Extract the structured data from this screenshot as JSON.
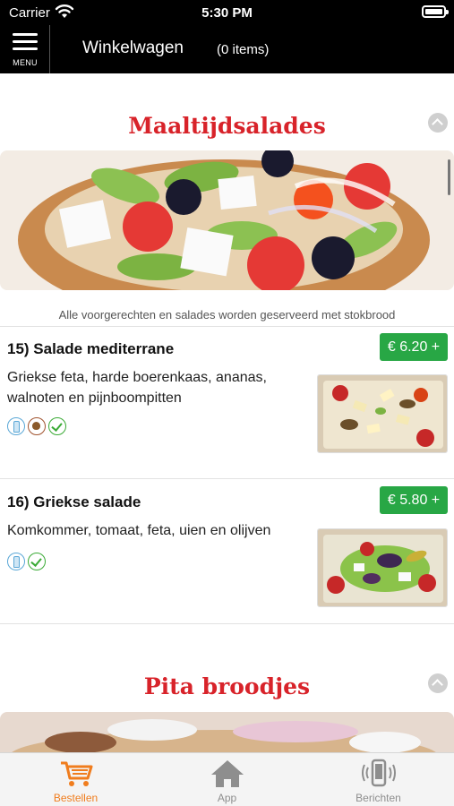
{
  "status_bar": {
    "carrier": "Carrier",
    "time": "5:30 PM"
  },
  "nav": {
    "menu_label": "MENU",
    "title": "Winkelwagen",
    "item_count": "(0 items)"
  },
  "sections": [
    {
      "title": "Maaltijdsalades",
      "note": "Alle voorgerechten en salades worden geserveerd met stokbrood",
      "products": [
        {
          "name": "15)  Salade mediterrane",
          "description": "Griekse feta, harde boerenkaas, ananas, walnoten en pijnboompitten",
          "price": "€ 6.20 +",
          "allergens": [
            "milk-icon",
            "nut-icon",
            "vegetarian-icon"
          ]
        },
        {
          "name": "16)  Griekse salade",
          "description": "Komkommer, tomaat, feta, uien en olijven",
          "price": "€ 5.80 +",
          "allergens": [
            "milk-icon",
            "vegetarian-icon"
          ]
        }
      ]
    },
    {
      "title": "Pita broodjes"
    }
  ],
  "tabs": [
    {
      "label": "Bestellen",
      "icon": "cart-icon",
      "active": true
    },
    {
      "label": "App",
      "icon": "home-icon",
      "active": false
    },
    {
      "label": "Berichten",
      "icon": "phone-vibrate-icon",
      "active": false
    }
  ],
  "colors": {
    "accent": "#d8232a",
    "price": "#28a745",
    "active_tab": "#f07d1e",
    "inactive_tab": "#8e8e8e"
  }
}
